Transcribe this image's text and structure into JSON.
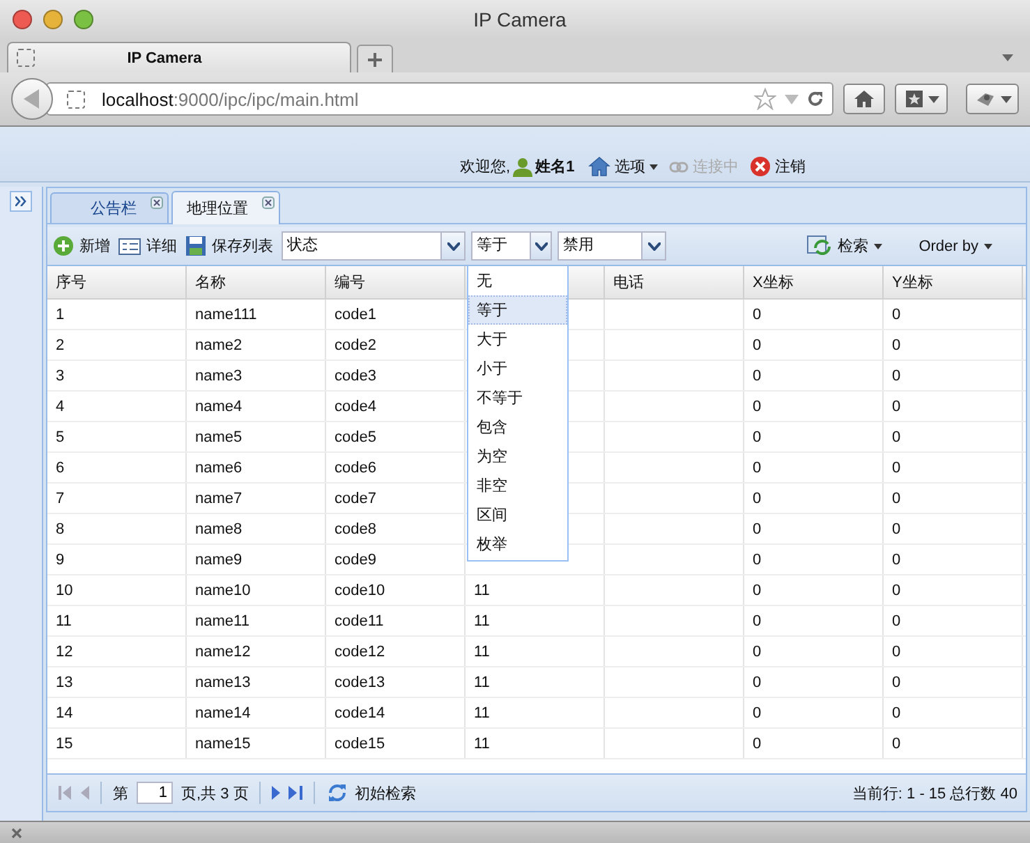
{
  "window": {
    "title": "IP Camera"
  },
  "browser": {
    "tab": "IP Camera",
    "url_host": "localhost",
    "url_path": ":9000/ipc/ipc/main.html"
  },
  "header": {
    "welcome": "欢迎您,",
    "user": "姓名1",
    "options": "选项",
    "connection": {
      "label": "连接中",
      "disabled": true
    },
    "logout": "注销"
  },
  "tabs": [
    {
      "label": "公告栏",
      "selected": false
    },
    {
      "label": "地理位置",
      "selected": true
    }
  ],
  "toolbar": {
    "add": "新增",
    "detail": "详细",
    "save": "保存列表",
    "field": "状态",
    "operator": "等于",
    "value": "禁用",
    "search": "检索",
    "order": "Order by"
  },
  "operator_options": [
    {
      "label": "无",
      "selected": false
    },
    {
      "label": "等于",
      "selected": true
    },
    {
      "label": "大于",
      "selected": false
    },
    {
      "label": "小于",
      "selected": false
    },
    {
      "label": "不等于",
      "selected": false
    },
    {
      "label": "包含",
      "selected": false
    },
    {
      "label": "为空",
      "selected": false
    },
    {
      "label": "非空",
      "selected": false
    },
    {
      "label": "区间",
      "selected": false
    },
    {
      "label": "枚举",
      "selected": false
    }
  ],
  "table": {
    "columns": [
      "序号",
      "名称",
      "编号",
      null,
      "电话",
      "X坐标",
      "Y坐标"
    ],
    "rows": [
      {
        "cells": [
          "1",
          "name111",
          "code1",
          null,
          null,
          "0",
          "0"
        ]
      },
      {
        "cells": [
          "2",
          "name2",
          "code2",
          null,
          null,
          "0",
          "0"
        ]
      },
      {
        "cells": [
          "3",
          "name3",
          "code3",
          null,
          null,
          "0",
          "0"
        ]
      },
      {
        "cells": [
          "4",
          "name4",
          "code4",
          null,
          null,
          "0",
          "0"
        ]
      },
      {
        "cells": [
          "5",
          "name5",
          "code5",
          null,
          null,
          "0",
          "0"
        ]
      },
      {
        "cells": [
          "6",
          "name6",
          "code6",
          null,
          null,
          "0",
          "0"
        ]
      },
      {
        "cells": [
          "7",
          "name7",
          "code7",
          null,
          null,
          "0",
          "0"
        ]
      },
      {
        "cells": [
          "8",
          "name8",
          "code8",
          null,
          null,
          "0",
          "0"
        ]
      },
      {
        "cells": [
          "9",
          "name9",
          "code9",
          null,
          null,
          "0",
          "0"
        ]
      },
      {
        "cells": [
          "10",
          "name10",
          "code10",
          "11",
          null,
          "0",
          "0"
        ]
      },
      {
        "cells": [
          "11",
          "name11",
          "code11",
          "11",
          null,
          "0",
          "0"
        ]
      },
      {
        "cells": [
          "12",
          "name12",
          "code12",
          "11",
          null,
          "0",
          "0"
        ]
      },
      {
        "cells": [
          "13",
          "name13",
          "code13",
          "11",
          null,
          "0",
          "0"
        ]
      },
      {
        "cells": [
          "14",
          "name14",
          "code14",
          "11",
          null,
          "0",
          "0"
        ]
      },
      {
        "cells": [
          "15",
          "name15",
          "code15",
          "11",
          null,
          "0",
          "0"
        ]
      }
    ]
  },
  "pager": {
    "page_prefix": "第",
    "page": "1",
    "page_suffix": "页,共 3 页",
    "reset": "初始检索",
    "summary": "当前行: 1 - 15 总行数 40"
  }
}
